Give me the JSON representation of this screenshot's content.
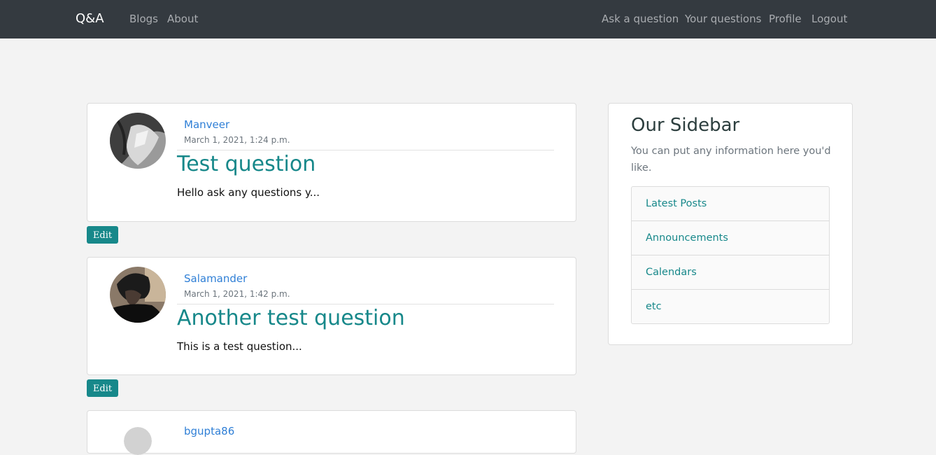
{
  "nav": {
    "brand": "Q&A",
    "left_links": [
      "Blogs",
      "About"
    ],
    "right_links": [
      "Ask a question",
      "Your questions",
      "Profile",
      "Logout"
    ]
  },
  "posts": [
    {
      "author": "Manveer",
      "date": "March 1, 2021, 1:24 p.m.",
      "title": "Test question",
      "excerpt": "Hello ask any questions y...",
      "edit_label": "Edit"
    },
    {
      "author": "Salamander",
      "date": "March 1, 2021, 1:42 p.m.",
      "title": "Another test question",
      "excerpt": "This is a test question...",
      "edit_label": "Edit"
    },
    {
      "author": "bgupta86"
    }
  ],
  "sidebar": {
    "title": "Our Sidebar",
    "description": "You can put any information here you'd like.",
    "items": [
      "Latest Posts",
      "Announcements",
      "Calendars",
      "etc"
    ]
  },
  "colors": {
    "accent": "#17888a",
    "navbar": "#343a40",
    "link": "#2f7fd6"
  }
}
